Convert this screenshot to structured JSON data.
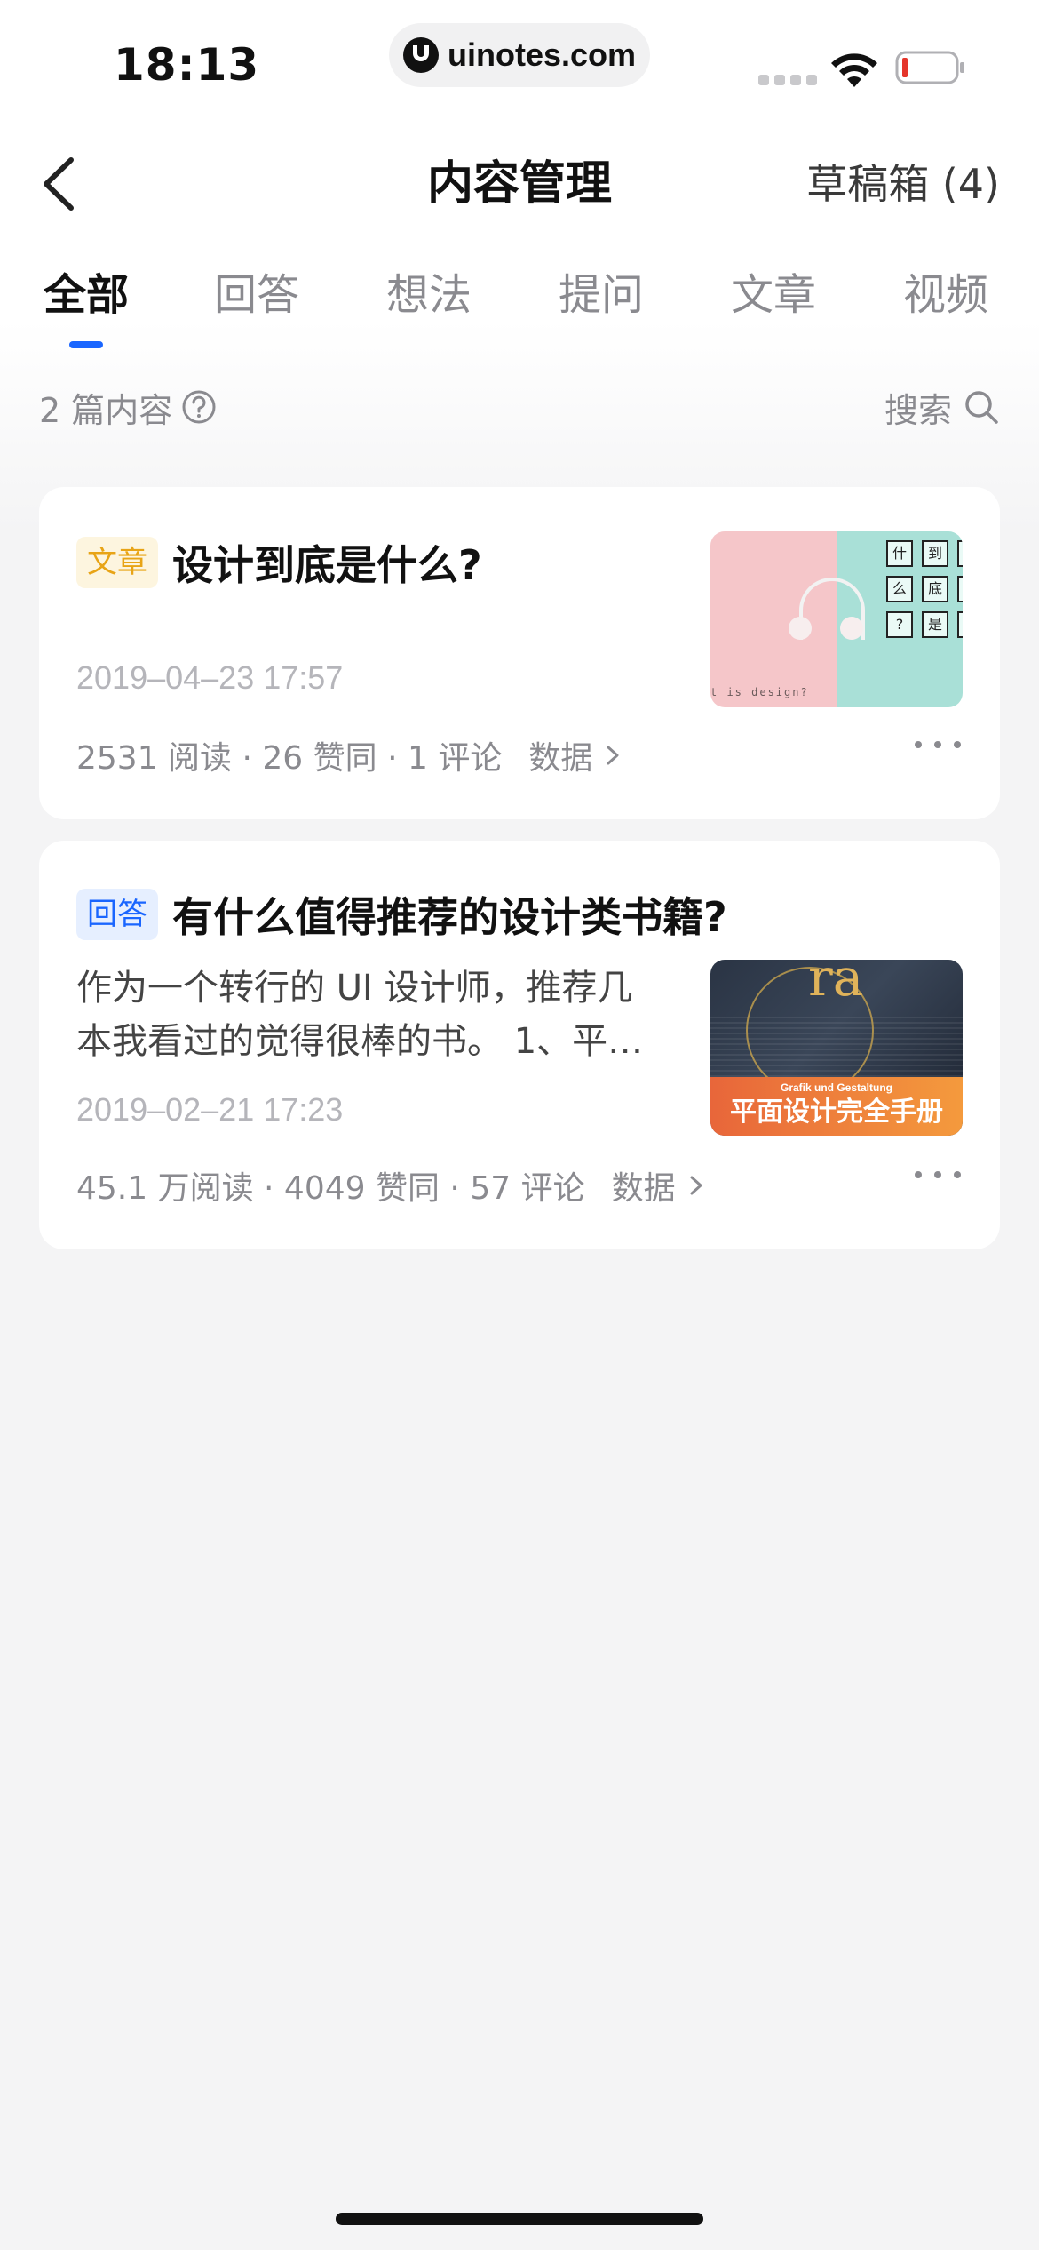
{
  "status_bar": {
    "time": "18:13",
    "url": "uinotes.com"
  },
  "nav": {
    "title": "内容管理",
    "drafts_label": "草稿箱 (4)"
  },
  "tabs": [
    {
      "label": "全部",
      "active": true
    },
    {
      "label": "回答",
      "active": false
    },
    {
      "label": "想法",
      "active": false
    },
    {
      "label": "提问",
      "active": false
    },
    {
      "label": "文章",
      "active": false
    },
    {
      "label": "视频",
      "active": false
    }
  ],
  "summary": {
    "count_label": "2 篇内容",
    "search_label": "搜索"
  },
  "items": [
    {
      "tag": "文章",
      "title": "设计到底是什么?",
      "date": "2019–04–23 17:57",
      "stats": "2531 阅读 · 26 赞同 · 1 评论",
      "data_label": "数据",
      "thumb": {
        "chars": [
          "什",
          "到",
          "",
          "么",
          "底",
          "",
          "?",
          "是",
          ""
        ],
        "caption": "t is design?"
      }
    },
    {
      "tag": "回答",
      "title": "有什么值得推荐的设计类书籍?",
      "excerpt": "作为一个转行的 UI 设计师，推荐几本我看过的觉得很棒的书。 1、平…",
      "date": "2019–02–21 17:23",
      "stats": "45.1 万阅读 · 4049 赞同 · 57 评论",
      "data_label": "数据",
      "thumb": {
        "letters": "ra",
        "sub": "Grafik und Gestaltung",
        "main": "平面设计完全手册"
      }
    }
  ],
  "colors": {
    "accent": "#1a66ff",
    "tag_article_text": "#e8a416",
    "tag_article_bg": "#fdf5df",
    "tag_answer_text": "#1a66ff",
    "tag_answer_bg": "#e6efff",
    "muted": "#8a8a8f"
  },
  "icons": {
    "back": "chevron-left-icon",
    "help": "question-circle-icon",
    "search": "search-icon",
    "more": "more-dots-icon",
    "chevron": "chevron-right-icon"
  }
}
